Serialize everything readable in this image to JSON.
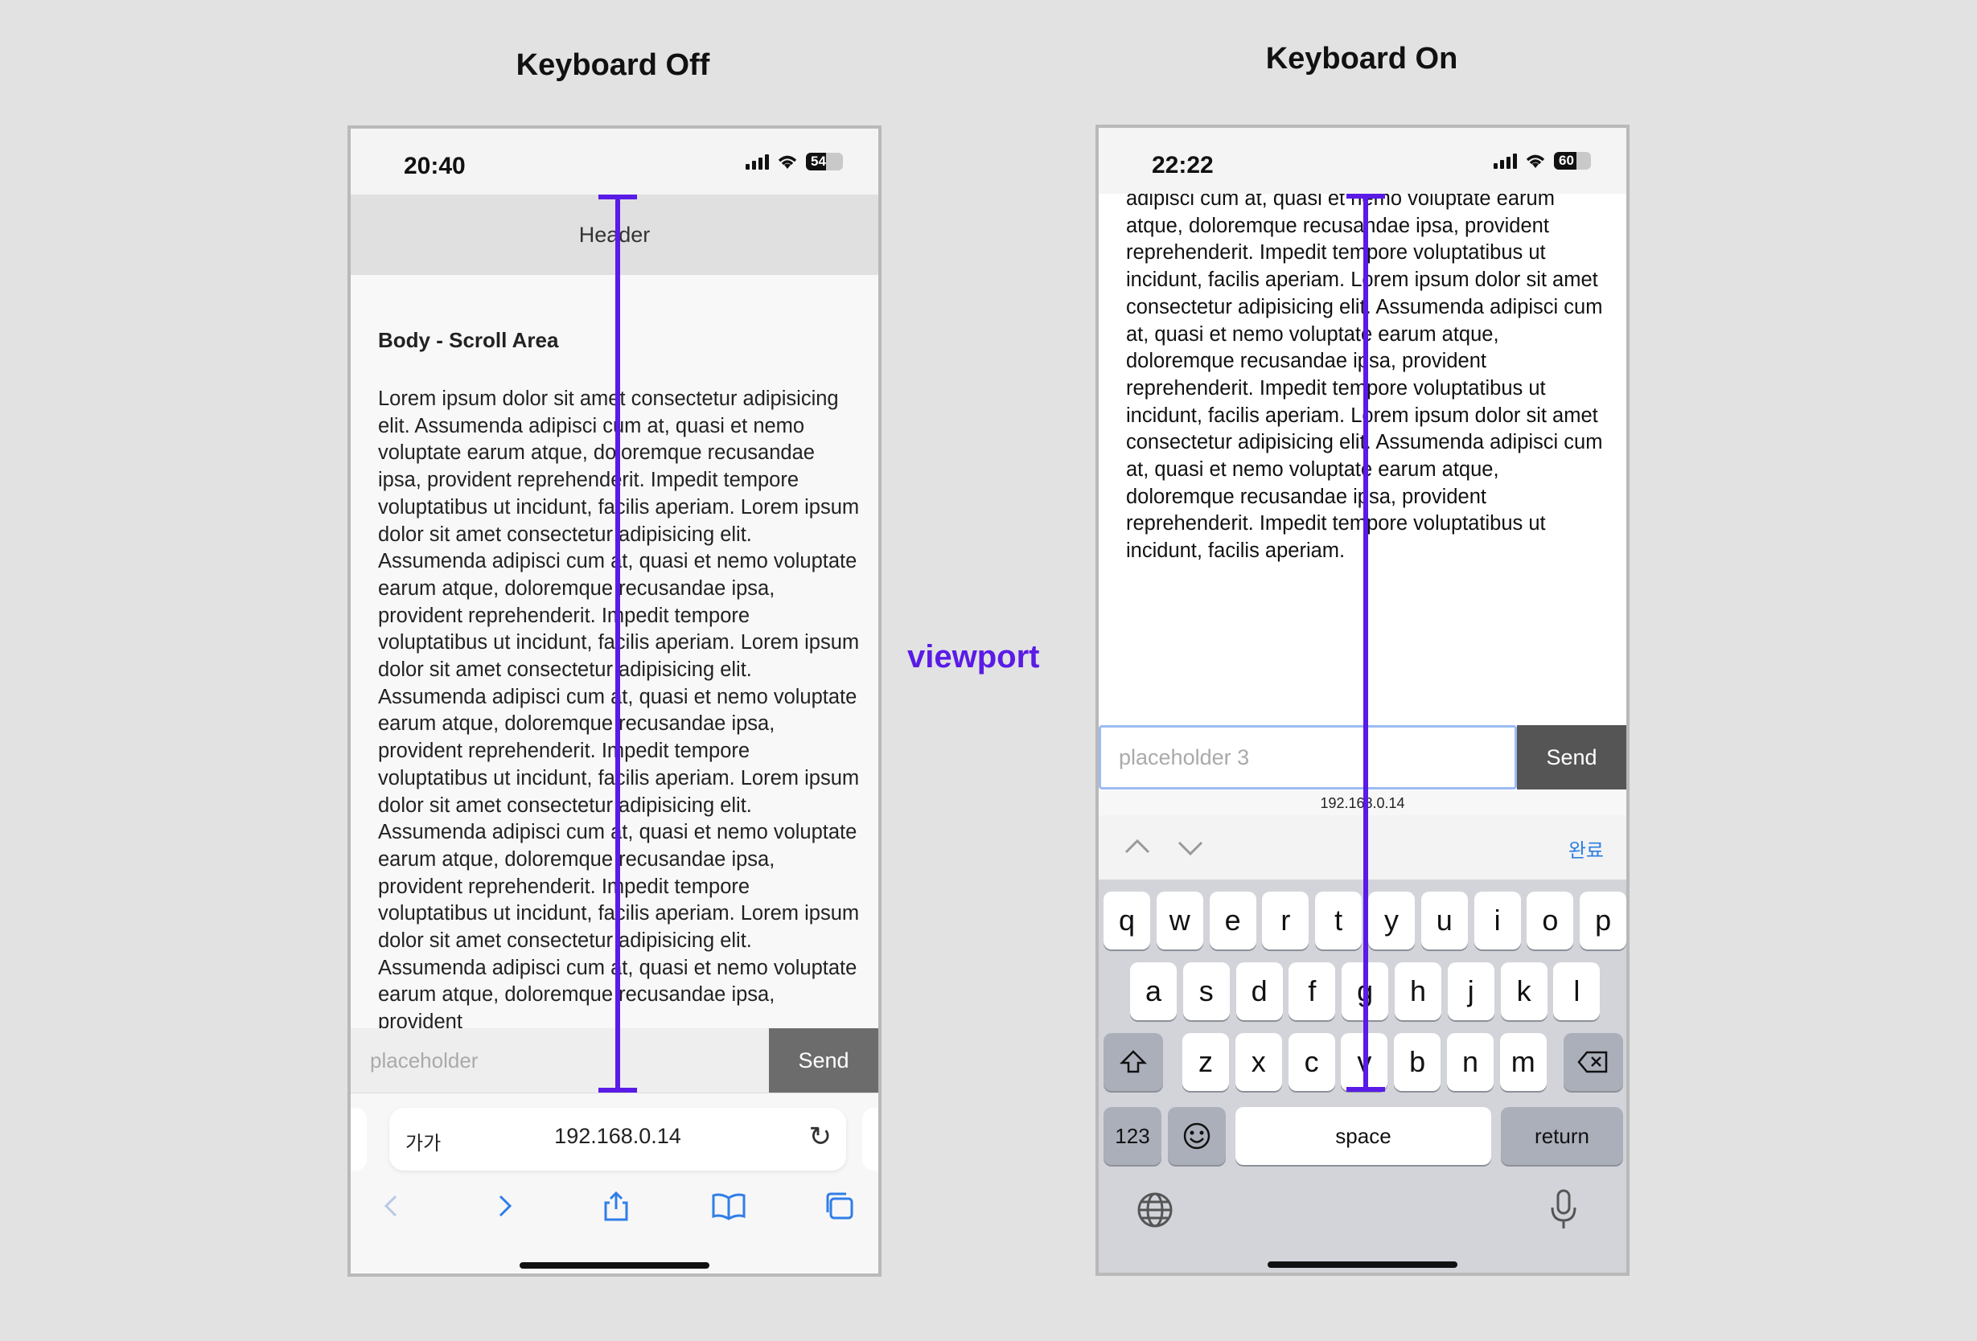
{
  "titles": {
    "left": "Keyboard Off",
    "right": "Keyboard On",
    "center": "viewport"
  },
  "colors": {
    "accent": "#5a1be6",
    "link_blue": "#2a7de1",
    "send_bg": "#555555"
  },
  "lorem_text": "Lorem ipsum dolor sit amet consectetur adipisicing elit. Assumenda adipisci cum at, quasi et nemo voluptate earum atque, doloremque recusandae ipsa, provident reprehenderit. Impedit tempore voluptatibus ut incidunt, facilis aperiam. Lorem ipsum dolor sit amet consectetur adipisicing elit. Assumenda adipisci cum at, quasi et nemo voluptate earum atque, doloremque recusandae ipsa, provident reprehenderit. Impedit tempore voluptatibus ut incidunt, facilis aperiam. Lorem ipsum dolor sit amet consectetur adipisicing elit. Assumenda adipisci cum at, quasi et nemo voluptate earum atque, doloremque recusandae ipsa, provident reprehenderit. Impedit tempore voluptatibus ut incidunt, facilis aperiam. Lorem ipsum dolor sit amet consectetur adipisicing elit. Assumenda adipisci cum at, quasi et nemo voluptate earum atque, doloremque recusandae ipsa, provident reprehenderit. Impedit tempore voluptatibus ut incidunt, facilis aperiam. Lorem ipsum dolor sit amet consectetur adipisicing elit. Assumenda adipisci cum at, quasi et nemo voluptate earum atque, doloremque recusandae ipsa, provident",
  "lorem_text_on": "adipisci cum at, quasi et nemo voluptate earum atque, doloremque recusandae ipsa, provident reprehenderit. Impedit tempore voluptatibus ut incidunt, facilis aperiam. Lorem ipsum dolor sit amet consectetur adipisicing elit. Assumenda adipisci cum at, quasi et nemo voluptate earum atque, doloremque recusandae ipsa, provident reprehenderit. Impedit tempore voluptatibus ut incidunt, facilis aperiam. Lorem ipsum dolor sit amet consectetur adipisicing elit. Assumenda adipisci cum at, quasi et nemo voluptate earum atque, doloremque recusandae ipsa, provident reprehenderit. Impedit tempore voluptatibus ut incidunt, facilis aperiam.",
  "phone_off": {
    "time": "20:40",
    "battery": "54",
    "battery_level": 0.54,
    "header": "Header",
    "body_title": "Body - Scroll Area",
    "input_placeholder": "placeholder",
    "send": "Send",
    "url_aa": "가가",
    "url": "192.168.0.14",
    "icons": [
      "signal-icon",
      "wifi-icon",
      "battery-icon",
      "reload-icon",
      "back-icon",
      "forward-icon",
      "share-icon",
      "bookmarks-icon",
      "tabs-icon"
    ]
  },
  "phone_on": {
    "time": "22:22",
    "battery": "60",
    "battery_level": 0.6,
    "input_placeholder": "placeholder 3",
    "send": "Send",
    "url": "192.168.0.14",
    "done": "완료",
    "keys_row1": [
      "q",
      "w",
      "e",
      "r",
      "t",
      "y",
      "u",
      "i",
      "o",
      "p"
    ],
    "keys_row2": [
      "a",
      "s",
      "d",
      "f",
      "g",
      "h",
      "j",
      "k",
      "l"
    ],
    "keys_row3": [
      "z",
      "x",
      "c",
      "v",
      "b",
      "n",
      "m"
    ],
    "key_123": "123",
    "key_space": "space",
    "key_return": "return",
    "icons": [
      "shift-icon",
      "backspace-icon",
      "emoji-icon",
      "globe-icon",
      "microphone-icon",
      "chevron-up-icon",
      "chevron-down-icon"
    ]
  }
}
